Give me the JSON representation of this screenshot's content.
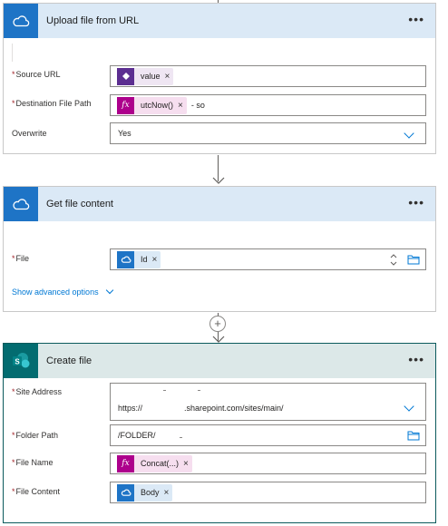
{
  "upload_card": {
    "title": "Upload file from URL",
    "more": "•••",
    "source_url": {
      "label": "Source URL",
      "required": "*",
      "chip": "value"
    },
    "destination": {
      "label": "Destination File Path",
      "required": "*",
      "chip": "utcNow()",
      "suffix": "- so"
    },
    "overwrite": {
      "label": "Overwrite",
      "value": "Yes"
    }
  },
  "get_content_card": {
    "title": "Get file content",
    "more": "•••",
    "file": {
      "label": "File",
      "required": "*",
      "chip": "Id"
    },
    "advanced": "Show advanced options"
  },
  "create_card": {
    "title": "Create file",
    "more": "•••",
    "site_address": {
      "label": "Site Address",
      "required": "*",
      "value_prefix": "https://",
      "value_suffix": ".sharepoint.com/sites/main/"
    },
    "folder_path": {
      "label": "Folder Path",
      "required": "*",
      "value": "/FOLDER/"
    },
    "file_name": {
      "label": "File Name",
      "required": "*",
      "chip": "Concat(...)"
    },
    "file_content": {
      "label": "File Content",
      "required": "*",
      "chip": "Body"
    }
  },
  "chip_remove": "×",
  "fx_glyph": "fx",
  "add_step": "+",
  "colors": {
    "onedrive": "#1e74c6",
    "sharepoint": "#036c70",
    "expression": "#ad008c",
    "dynamic": "#5c2e91",
    "link": "#0078d4"
  },
  "icons": [
    "onedrive-cloud-icon",
    "sharepoint-icon",
    "expression-icon",
    "dynamic-content-icon",
    "folder-icon",
    "chevron-down-icon",
    "more-icon",
    "arrow-down-icon",
    "plus-icon",
    "spinner-icon"
  ]
}
